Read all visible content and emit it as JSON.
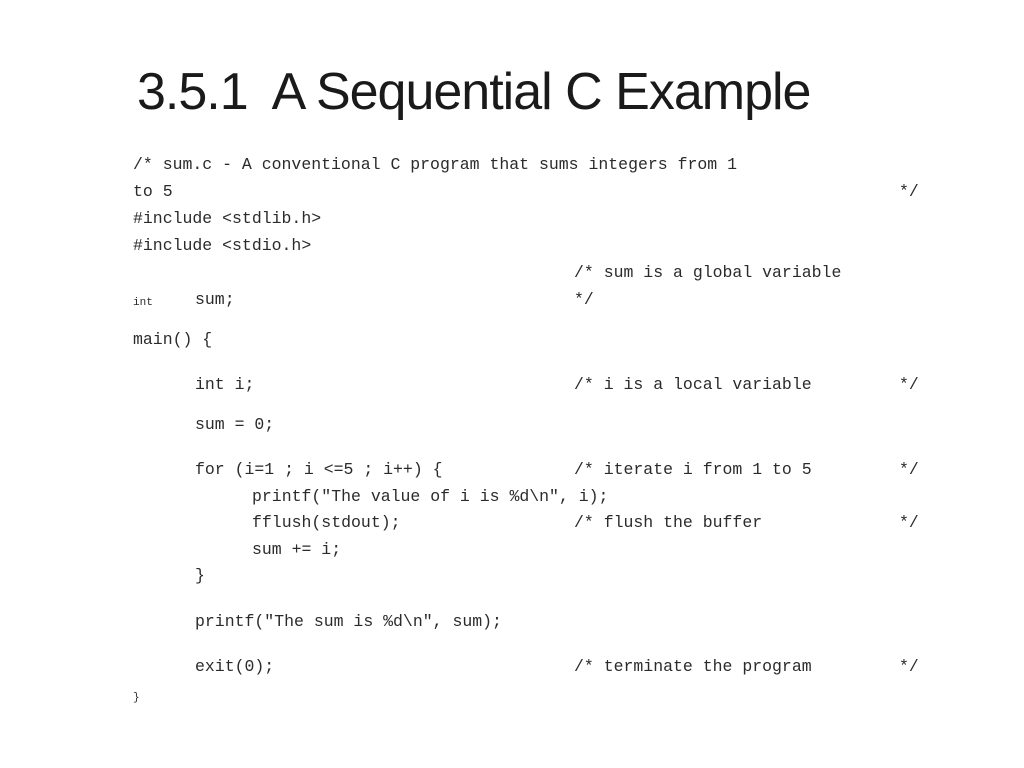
{
  "slide": {
    "title": "3.5.1  A Sequential C Example",
    "code": {
      "header_comment_1": "/* sum.c - A conventional C program that sums integers from 1",
      "header_comment_2": "to 5",
      "header_comment_end": "*/",
      "include_stdlib": "#include <stdlib.h>",
      "include_stdio": "#include <stdio.h>",
      "global_comment_1": "/* sum is a global variable",
      "global_comment_end": "*/",
      "global_int": "int",
      "global_sum": "sum;",
      "main_open": "main() {",
      "int_i": "int i;",
      "int_i_comment": "/* i is a local variable",
      "int_i_comment_end": "*/",
      "sum_init": "sum = 0;",
      "for_line": "for (i=1 ; i <=5 ; i++) {",
      "for_comment": "/* iterate i from 1 to 5",
      "for_comment_end": "*/",
      "printf_value": "printf(\"The value of i is %d\\n\", i);",
      "fflush": "fflush(stdout);",
      "fflush_comment": "/* flush the buffer",
      "fflush_comment_end": "*/",
      "sum_add": "sum += i;",
      "for_close": "}",
      "printf_sum": "printf(\"The sum is %d\\n\", sum);",
      "exit": "exit(0);",
      "exit_comment": "/* terminate the program",
      "exit_comment_end": "*/",
      "main_close": "}"
    }
  }
}
